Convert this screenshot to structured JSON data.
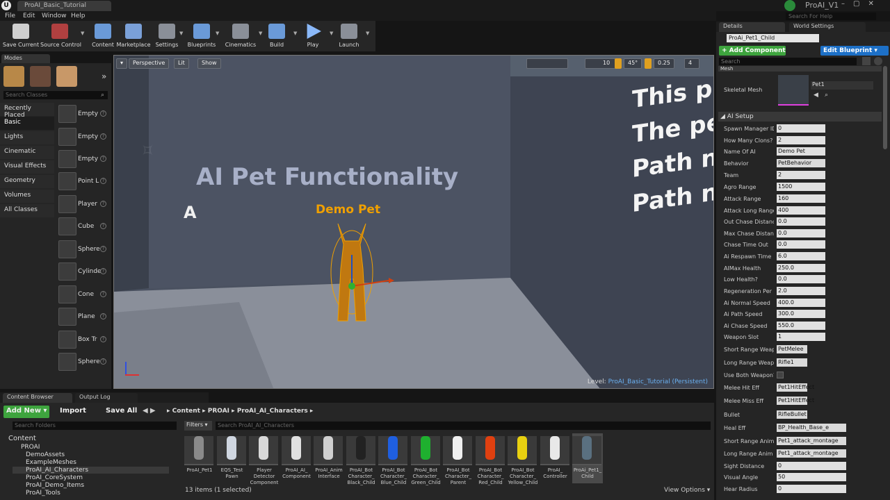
{
  "titlebar": {
    "tab": "ProAI_Basic_Tutorial",
    "project": "ProAI_V1",
    "logo": "U"
  },
  "menu": [
    "File",
    "Edit",
    "Window",
    "Help"
  ],
  "search_help": "Search For Help",
  "toolbar": [
    {
      "label": "Save Current",
      "icon": "save-icon",
      "color": "#cfcfcf"
    },
    {
      "label": "Source Control",
      "icon": "source-control-icon",
      "color": "#b04040"
    },
    {
      "label": "Content",
      "icon": "content-icon",
      "color": "#6a9ad8"
    },
    {
      "label": "Marketplace",
      "icon": "marketplace-icon",
      "color": "#7aa0d8"
    },
    {
      "label": "Settings",
      "icon": "settings-icon",
      "color": "#8a8f98"
    },
    {
      "label": "Blueprints",
      "icon": "blueprints-icon",
      "color": "#6a9ad8"
    },
    {
      "label": "Cinematics",
      "icon": "cinematics-icon",
      "color": "#8a8f98"
    },
    {
      "label": "Build",
      "icon": "build-icon",
      "color": "#6a9ad8"
    },
    {
      "label": "Play",
      "icon": "play-icon",
      "color": "#8ab8f8"
    },
    {
      "label": "Launch",
      "icon": "launch-icon",
      "color": "#8a8f98"
    }
  ],
  "modes": {
    "tab": "Modes",
    "search_placeholder": "Search Classes",
    "categories": [
      "Recently Placed",
      "Basic",
      "Lights",
      "Cinematic",
      "Visual Effects",
      "Geometry",
      "Volumes",
      "All Classes"
    ],
    "items": [
      "Empty",
      "Empty",
      "Empty",
      "Point L",
      "Player",
      "Cube",
      "Sphere",
      "Cylinde",
      "Cone",
      "Plane",
      "Box Tr",
      "Sphere"
    ]
  },
  "viewport": {
    "buttons": [
      "Perspective",
      "Lit",
      "Show"
    ],
    "snap": [
      "10",
      "45°",
      "0.25",
      "4"
    ],
    "wall_title": "AI Pet Functionality",
    "pet_label": "Demo Pet",
    "side_text": [
      "This p",
      "The pe",
      "Path n",
      "Path n"
    ],
    "level_prefix": "Level: ",
    "level_name": "ProAI_Basic_Tutorial (Persistent)"
  },
  "details": {
    "tabs": [
      "Details",
      "World Settings"
    ],
    "actor_name": "ProAi_Pet1_Child",
    "add_component": "+ Add Component ▾",
    "edit_blueprint": "Edit Blueprint ▾",
    "search_placeholder": "Search",
    "mesh_header": "Mesh",
    "skeletal_mesh_label": "Skeletal Mesh",
    "skeletal_mesh_value": "Pet1",
    "ai_setup": "AI Setup",
    "props": [
      {
        "label": "Spawn Manager ID",
        "value": "0"
      },
      {
        "label": "How Many Clons?",
        "value": "2"
      },
      {
        "label": "Name Of AI",
        "value": "Demo Pet"
      },
      {
        "label": "Behavior",
        "value": "PetBehavior"
      },
      {
        "label": "Team",
        "value": "2"
      },
      {
        "label": "Agro Range",
        "value": "1500"
      },
      {
        "label": "Attack Range",
        "value": "160"
      },
      {
        "label": "Attack Long Range",
        "value": "400"
      },
      {
        "label": "Out Chase Distance",
        "value": "0.0"
      },
      {
        "label": "Max Chase Distance",
        "value": "0.0"
      },
      {
        "label": "Chase Time Out",
        "value": "0.0"
      },
      {
        "label": "Ai Respawn Time",
        "value": "6.0"
      },
      {
        "label": "AIMax Health",
        "value": "250.0"
      },
      {
        "label": "Low Health?",
        "value": "0.0"
      },
      {
        "label": "Regeneration Per S",
        "value": "2.0"
      },
      {
        "label": "Ai Normal Speed",
        "value": "400.0"
      },
      {
        "label": "Ai Path Speed",
        "value": "300.0"
      },
      {
        "label": "Ai Chase Speed",
        "value": "550.0"
      },
      {
        "label": "Weapon Slot",
        "value": "1"
      },
      {
        "label": "Short Range Weapon",
        "value": "PetMelee"
      },
      {
        "label": "Long Range Weapon",
        "value": "Rifle1"
      },
      {
        "label": "Use Both Weapon?",
        "value": ""
      },
      {
        "label": "Melee Hit Eff",
        "value": "Pet1HitEffect"
      },
      {
        "label": "Melee Miss Eff",
        "value": "Pet1HitEffect"
      },
      {
        "label": "Bullet",
        "value": "RifleBullet"
      },
      {
        "label": "Heal Eff",
        "value": "BP_Health_Base_e"
      },
      {
        "label": "Short Range Anim M",
        "value": "Pet1_attack_montage"
      },
      {
        "label": "Long Range Anim M",
        "value": "Pet1_attack_montage"
      },
      {
        "label": "Sight Distance",
        "value": "0"
      },
      {
        "label": "Visual Angle",
        "value": "50"
      },
      {
        "label": "Hear Radius",
        "value": "0"
      }
    ]
  },
  "content_browser": {
    "tabs": [
      "Content Browser",
      "Output Log"
    ],
    "add_new": "Add New ▾",
    "import": "Import",
    "save_all": "Save All",
    "path": [
      "Content",
      "PROAI",
      "ProAI_AI_Characters"
    ],
    "folders_placeholder": "Search Folders",
    "filters": "Filters ▾",
    "assets_placeholder": "Search ProAI_AI_Characters",
    "tree": [
      "Content",
      "PROAI",
      "DemoAssets",
      "ExampleMeshes",
      "ProAI_AI_Characters",
      "ProAI_CoreSystem",
      "ProAI_Demo_Items",
      "ProAI_Tools"
    ],
    "assets": [
      {
        "name": "ProAI_Pet1",
        "color": "#8a8a8a"
      },
      {
        "name": "EQS_Test Pawn",
        "color": "#cfd6e0"
      },
      {
        "name": "Player Detector Component",
        "color": "#d8d8d8"
      },
      {
        "name": "ProAI_AI_ Component",
        "color": "#e0e0e0"
      },
      {
        "name": "ProAI_Anim Interface",
        "color": "#d0d0d0"
      },
      {
        "name": "ProAI_Bot Character_ Black_Child",
        "color": "#222"
      },
      {
        "name": "ProAI_Bot Character_ Blue_Child",
        "color": "#1f5fe0"
      },
      {
        "name": "ProAI_Bot Character_ Green_Child",
        "color": "#1fb02f"
      },
      {
        "name": "ProAI_Bot Character_ Parent",
        "color": "#f0f0f0"
      },
      {
        "name": "ProAI_Bot Character_ Red_Child",
        "color": "#e04010"
      },
      {
        "name": "ProAI_Bot Character_ Yellow_Child",
        "color": "#e8d010"
      },
      {
        "name": "ProAI_ Controller",
        "color": "#e8e8e8"
      },
      {
        "name": "ProAi_Pet1_ Child",
        "color": "#5a7080"
      }
    ],
    "count": "13 items (1 selected)",
    "view_options": "View Options ▾"
  },
  "colors": {
    "selection": "#f0a000",
    "accent": "#2a7ad8",
    "green": "#3ea43e"
  }
}
